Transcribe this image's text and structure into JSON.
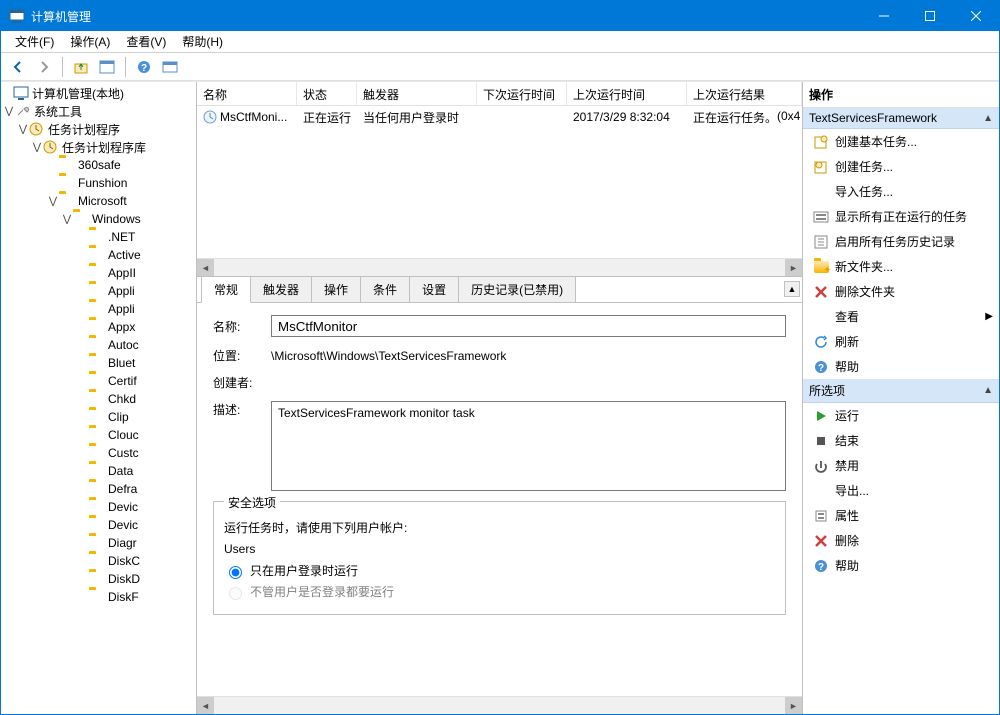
{
  "window": {
    "title": "计算机管理"
  },
  "menubar": [
    "文件(F)",
    "操作(A)",
    "查看(V)",
    "帮助(H)"
  ],
  "tree": {
    "root": "计算机管理(本地)",
    "system_tools": "系统工具",
    "scheduler": "任务计划程序",
    "library": "任务计划程序库",
    "folders": [
      "360safe",
      "Funshion",
      "Microsoft",
      "Windows",
      ".NET",
      "Active",
      "AppII",
      "Appli",
      "Appli",
      "Appx",
      "Autoc",
      "Bluet",
      "Certif",
      "Chkd",
      "Clip",
      "Clouc",
      "Custc",
      "Data",
      "Defra",
      "Devic",
      "Devic",
      "Diagr",
      "DiskC",
      "DiskD",
      "DiskF"
    ]
  },
  "task_list": {
    "cols": [
      "名称",
      "状态",
      "触发器",
      "下次运行时间",
      "上次运行时间",
      "上次运行结果",
      ""
    ],
    "row": {
      "name": "MsCtfMoni...",
      "status": "正在运行",
      "trigger": "当任何用户登录时",
      "next": "",
      "last": "2017/3/29 8:32:04",
      "result": "正在运行任务。",
      "code": "(0x4"
    }
  },
  "tabs": [
    "常规",
    "触发器",
    "操作",
    "条件",
    "设置",
    "历史记录(已禁用)"
  ],
  "general": {
    "name_lbl": "名称:",
    "name_val": "MsCtfMonitor",
    "loc_lbl": "位置:",
    "loc_val": "\\Microsoft\\Windows\\TextServicesFramework",
    "creator_lbl": "创建者:",
    "creator_val": "",
    "desc_lbl": "描述:",
    "desc_val": "TextServicesFramework monitor task",
    "sec_legend": "安全选项",
    "sec_prompt": "运行任务时，请使用下列用户帐户:",
    "sec_user": "Users",
    "radio1": "只在用户登录时运行",
    "radio2": "不管用户是否登录都要运行"
  },
  "actions": {
    "header": "操作",
    "section1": "TextServicesFramework",
    "items1": [
      {
        "icon": "task",
        "label": "创建基本任务..."
      },
      {
        "icon": "task2",
        "label": "创建任务..."
      },
      {
        "icon": "blank",
        "label": "导入任务..."
      },
      {
        "icon": "show",
        "label": "显示所有正在运行的任务"
      },
      {
        "icon": "history",
        "label": "启用所有任务历史记录"
      },
      {
        "icon": "newfolder",
        "label": "新文件夹..."
      },
      {
        "icon": "delx",
        "label": "删除文件夹"
      },
      {
        "icon": "blank",
        "label": "查看",
        "arrow": true
      },
      {
        "icon": "refresh",
        "label": "刷新"
      },
      {
        "icon": "help",
        "label": "帮助"
      }
    ],
    "section2": "所选项",
    "items2": [
      {
        "icon": "run",
        "label": "运行"
      },
      {
        "icon": "stop",
        "label": "结束"
      },
      {
        "icon": "disable",
        "label": "禁用"
      },
      {
        "icon": "blank",
        "label": "导出..."
      },
      {
        "icon": "props",
        "label": "属性"
      },
      {
        "icon": "delx",
        "label": "删除"
      },
      {
        "icon": "help",
        "label": "帮助"
      }
    ]
  }
}
